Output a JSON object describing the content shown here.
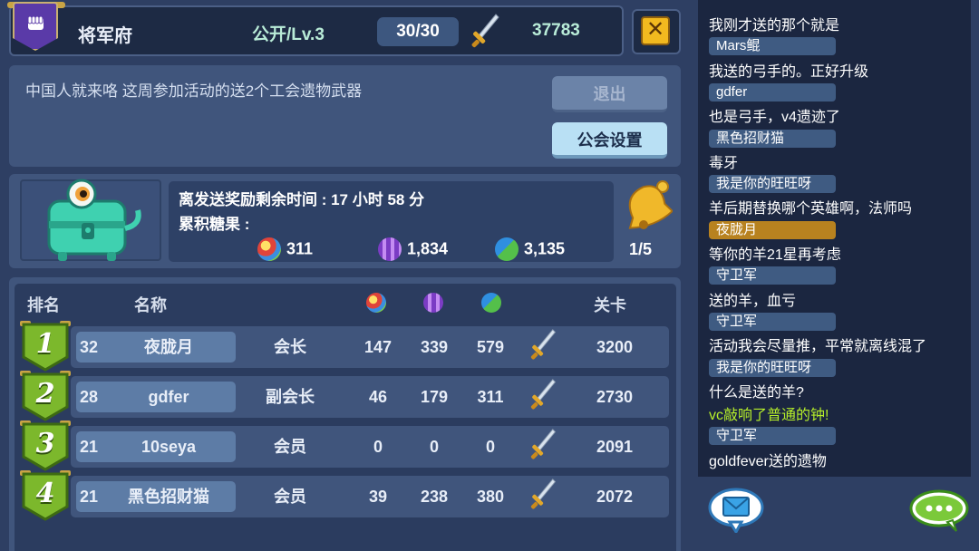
{
  "header": {
    "guild_name": "将军府",
    "guild_level": "公开/Lv.3",
    "member_count": "30/30",
    "guild_power": "37783",
    "close_label": "✕"
  },
  "notice": {
    "text": "中国人就来咯  这周参加活动的送2个工会遗物武器",
    "leave_label": "退出",
    "settings_label": "公会设置"
  },
  "reward": {
    "timer_text": "离发送奖励剩余时间 : 17 小时 58 分",
    "candy_label": "累积糖果 :",
    "candy_totals": [
      "311",
      "1,834",
      "3,135"
    ],
    "bell_count": "1/5"
  },
  "candy_colors": [
    "#e0443a",
    "#9a4fd6",
    "#3fae5a"
  ],
  "table": {
    "headers": {
      "rank": "排名",
      "name": "名称",
      "level": "关卡"
    },
    "rows": [
      {
        "rank": "1",
        "level": "32",
        "name": "夜胧月",
        "role": "会长",
        "a": "147",
        "b": "339",
        "c": "579",
        "stage": "3200"
      },
      {
        "rank": "2",
        "level": "28",
        "name": "gdfer",
        "role": "副会长",
        "a": "46",
        "b": "179",
        "c": "311",
        "stage": "2730"
      },
      {
        "rank": "3",
        "level": "21",
        "name": "10seya",
        "role": "会员",
        "a": "0",
        "b": "0",
        "c": "0",
        "stage": "2091"
      },
      {
        "rank": "4",
        "level": "21",
        "name": "黑色招财猫",
        "role": "会员",
        "a": "39",
        "b": "238",
        "c": "380",
        "stage": "2072"
      }
    ]
  },
  "chat": {
    "messages": [
      {
        "type": "text",
        "text": "我刚才送的那个就是"
      },
      {
        "type": "name",
        "text": "Mars鲲"
      },
      {
        "type": "text",
        "text": "我送的弓手的。正好升级"
      },
      {
        "type": "name",
        "text": "gdfer"
      },
      {
        "type": "text",
        "text": "也是弓手，v4遗迹了"
      },
      {
        "type": "name",
        "text": "黑色招财猫"
      },
      {
        "type": "text",
        "text": "毒牙"
      },
      {
        "type": "name",
        "text": "我是你的旺旺呀"
      },
      {
        "type": "text",
        "text": "羊后期替换哪个英雄啊，法师吗"
      },
      {
        "type": "name_gold",
        "text": "夜胧月"
      },
      {
        "type": "text",
        "text": "等你的羊21星再考虑"
      },
      {
        "type": "name",
        "text": "守卫军"
      },
      {
        "type": "text",
        "text": "送的羊，血亏"
      },
      {
        "type": "name",
        "text": "守卫军"
      },
      {
        "type": "text",
        "text": "活动我会尽量推，平常就离线混了"
      },
      {
        "type": "name",
        "text": "我是你的旺旺呀"
      },
      {
        "type": "text",
        "text": "什么是送的羊?"
      },
      {
        "type": "system",
        "text": "vc敲响了普通的钟!"
      },
      {
        "type": "name",
        "text": "守卫军"
      },
      {
        "type": "text",
        "text": "goldfever送的遗物"
      }
    ]
  }
}
